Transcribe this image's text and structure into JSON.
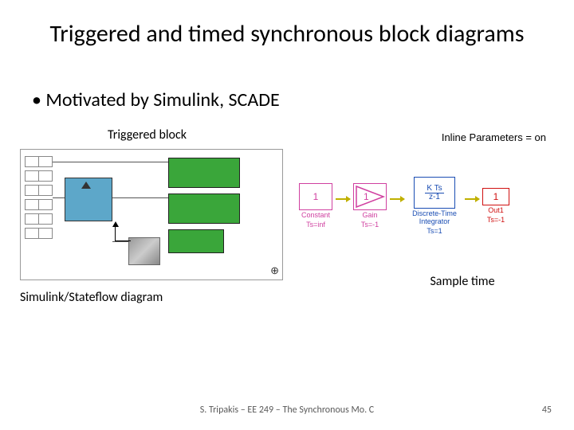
{
  "title": "Triggered and timed synchronous block diagrams",
  "bullet": "• Motivated by Simulink, SCADE",
  "left": {
    "triggered_label": "Triggered block",
    "caption": "Simulink/Stateflow diagram"
  },
  "right": {
    "inline_params": "Inline Parameters = on",
    "blocks": {
      "constant": {
        "value": "1",
        "name": "Constant",
        "ts": "Ts=inf"
      },
      "gain": {
        "value": "1",
        "name": "Gain",
        "ts": "Ts=-1"
      },
      "integrator": {
        "num": "K Ts",
        "den": "z-1",
        "name": "Discrete-Time Integrator",
        "ts": "Ts=1"
      },
      "out": {
        "value": "1",
        "name": "Out1",
        "ts": "Ts=-1"
      }
    },
    "caption": "Sample time"
  },
  "footer": "S. Tripakis – EE 249 – The Synchronous Mo. C",
  "page": "45"
}
